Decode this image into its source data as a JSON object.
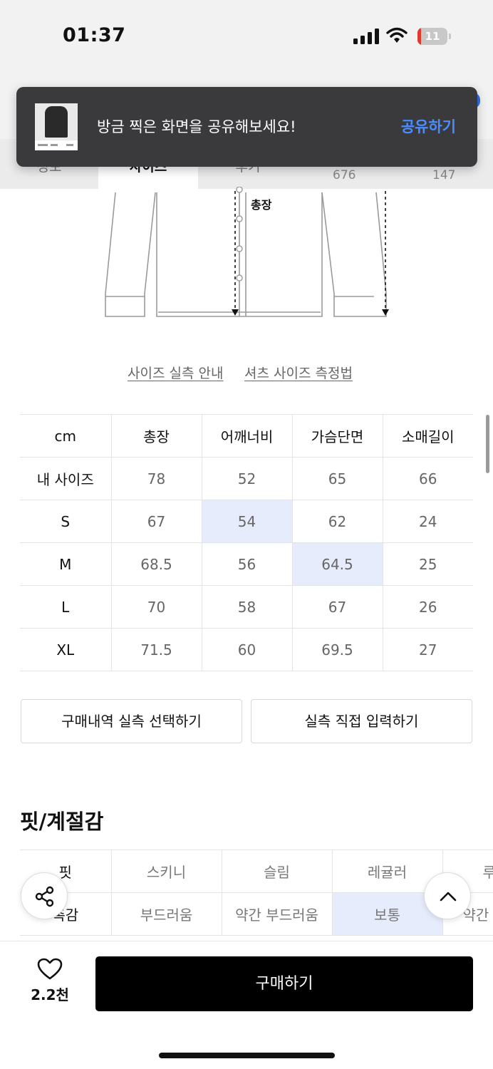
{
  "status_bar": {
    "time": "01:37",
    "battery": "11",
    "battery_level": 0.11
  },
  "tabs": [
    {
      "label": "정보"
    },
    {
      "label": "사이즈"
    },
    {
      "label": "후기"
    }
  ],
  "tab_counts": [
    "676",
    "147"
  ],
  "toast": {
    "message": "방금 찍은 화면을 공유해보세요!",
    "action": "공유하기"
  },
  "diagram": {
    "label": "총장"
  },
  "guide_links": [
    "사이즈 실측 안내",
    "셔츠 사이즈 측정법"
  ],
  "size_table": {
    "headers": [
      "cm",
      "총장",
      "어깨너비",
      "가슴단면",
      "소매길이"
    ],
    "rows": [
      {
        "label": "내 사이즈",
        "values": [
          "78",
          "52",
          "65",
          "66"
        ]
      },
      {
        "label": "S",
        "values": [
          "67",
          "54",
          "62",
          "24"
        ]
      },
      {
        "label": "M",
        "values": [
          "68.5",
          "56",
          "64.5",
          "25"
        ]
      },
      {
        "label": "L",
        "values": [
          "70",
          "58",
          "67",
          "26"
        ]
      },
      {
        "label": "XL",
        "values": [
          "71.5",
          "60",
          "69.5",
          "27"
        ]
      }
    ]
  },
  "size_actions": {
    "select_label": "구매내역 실측 선택하기",
    "input_label": "실측 직접 입력하기"
  },
  "fit_section": {
    "title": "핏/계절감",
    "rows": [
      {
        "label": "핏",
        "values": [
          "스키니",
          "슬림",
          "레귤러",
          "루"
        ]
      },
      {
        "label": "촉감",
        "values": [
          "부드러움",
          "약간 부드러움",
          "보통",
          "약간"
        ]
      }
    ]
  },
  "bottom_bar": {
    "like_count": "2.2천",
    "buy_label": "구매하기"
  },
  "icons": [
    "heart-icon",
    "share-icon",
    "chevron-up-icon",
    "wifi-icon",
    "signal-icon",
    "battery-icon"
  ],
  "colors": {
    "highlight": "#e6ecfb",
    "toast_action": "#4a8dff",
    "buy_button": "#000000"
  }
}
